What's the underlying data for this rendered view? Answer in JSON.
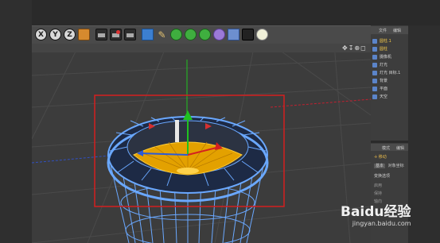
{
  "toolbar": {
    "axis_buttons": [
      "X",
      "Y",
      "Z"
    ]
  },
  "object_manager": {
    "header_tabs": [
      "文件",
      "编辑"
    ],
    "items": [
      {
        "label": "圆柱.1",
        "selected": true
      },
      {
        "label": "圆柱",
        "selected": true
      },
      {
        "label": "摄像机",
        "selected": false
      },
      {
        "label": "灯光",
        "selected": false
      },
      {
        "label": "灯光 目标.1",
        "selected": false
      },
      {
        "label": "背景",
        "selected": false
      },
      {
        "label": "平面",
        "selected": false
      },
      {
        "label": "天空",
        "selected": false
      }
    ]
  },
  "attributes": {
    "header_tabs": [
      "模式",
      "编辑"
    ],
    "title": "移动",
    "tabs": [
      "基本",
      "对象坐标"
    ],
    "section": "变换选项",
    "lines": [
      "启用",
      "保持",
      "轴向"
    ]
  },
  "watermark": {
    "brand": "Baidu经验",
    "url": "jingyan.baidu.com"
  },
  "colors": {
    "selection_box": "#d41f1f",
    "mesh_blue": "#6aa8ff",
    "fill_yellow": "#e3a100",
    "axis_green": "#1fc21f"
  }
}
